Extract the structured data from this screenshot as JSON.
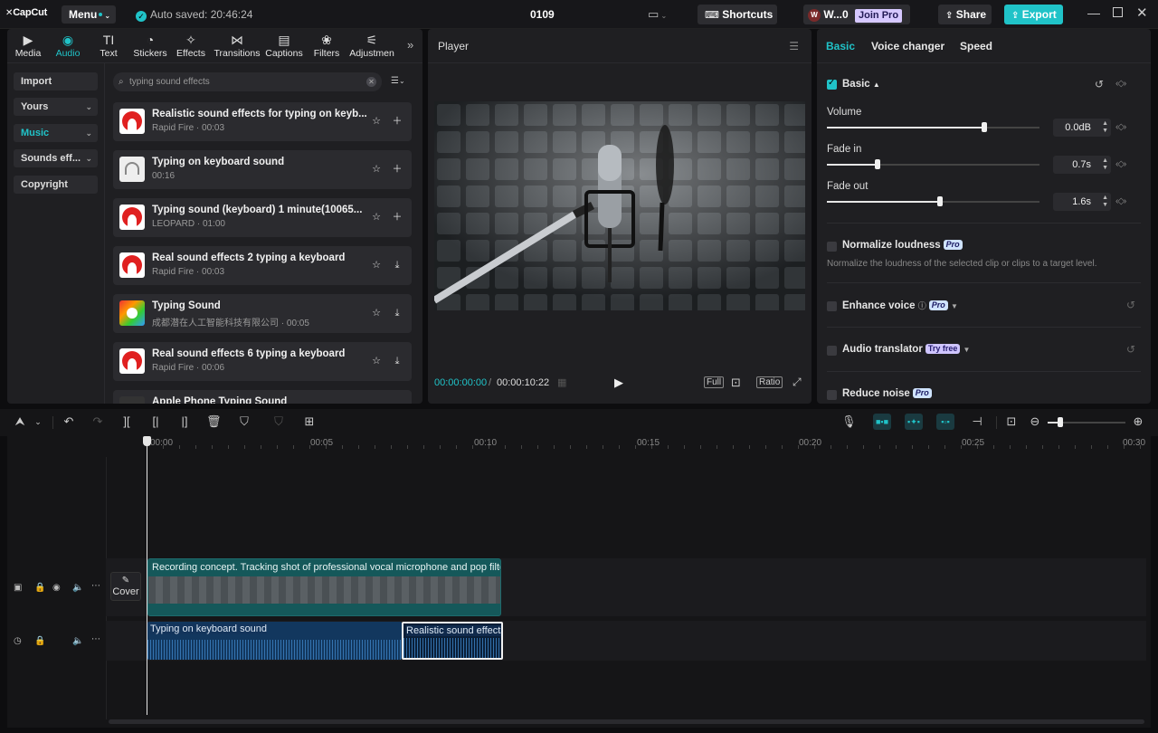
{
  "app": {
    "logo": "CapCut",
    "menu_label": "Menu",
    "autosave": "Auto saved: 20:46:24",
    "project_title": "0109",
    "shortcuts": "Shortcuts",
    "user": "W...0",
    "join_pro": "Join Pro",
    "share": "Share",
    "export": "Export"
  },
  "media": {
    "tabs": [
      {
        "label": "Media",
        "icon": "media-icon"
      },
      {
        "label": "Audio",
        "icon": "audio-icon"
      },
      {
        "label": "Text",
        "icon": "text-icon"
      },
      {
        "label": "Stickers",
        "icon": "stickers-icon"
      },
      {
        "label": "Effects",
        "icon": "effects-icon"
      },
      {
        "label": "Transitions",
        "icon": "transitions-icon"
      },
      {
        "label": "Captions",
        "icon": "captions-icon"
      },
      {
        "label": "Filters",
        "icon": "filters-icon"
      },
      {
        "label": "Adjustmen",
        "icon": "adjustment-icon"
      }
    ],
    "side": [
      "Import",
      "Yours",
      "Music",
      "Sounds eff...",
      "Copyright"
    ],
    "search_placeholder": "typing sound effects",
    "items": [
      {
        "title": "Realistic sound effects for typing on keyb...",
        "sub": "Rapid Fire · 00:03",
        "action": "add"
      },
      {
        "title": "Typing on keyboard sound",
        "sub": "00:16",
        "action": "add"
      },
      {
        "title": "Typing sound (keyboard) 1 minute(10065...",
        "sub": "LEOPARD · 01:00",
        "action": "add"
      },
      {
        "title": "Real sound effects 2 typing a keyboard",
        "sub": "Rapid Fire · 00:03",
        "action": "download"
      },
      {
        "title": "Typing Sound",
        "sub": "成都潜在人工智能科技有限公司 · 00:05",
        "action": "download"
      },
      {
        "title": "Real sound effects 6 typing a keyboard",
        "sub": "Rapid Fire · 00:06",
        "action": "download"
      },
      {
        "title": "Apple Phone Typing Sound",
        "sub": "",
        "action": "download"
      }
    ]
  },
  "player": {
    "title": "Player",
    "current": "00:00:00:00",
    "total": "00:00:10:22",
    "full": "Full",
    "ratio": "Ratio"
  },
  "props": {
    "tabs": [
      "Basic",
      "Voice changer",
      "Speed"
    ],
    "basic_title": "Basic",
    "volume_label": "Volume",
    "volume_value": "0.0dB",
    "volume_level": 0.74,
    "fadein_label": "Fade in",
    "fadein_value": "0.7s",
    "fadein_level": 0.24,
    "fadeout_label": "Fade out",
    "fadeout_value": "1.6s",
    "fadeout_level": 0.53,
    "normalize_title": "Normalize loudness",
    "normalize_desc": "Normalize the loudness of the selected clip or clips to a target level.",
    "enhance_title": "Enhance voice",
    "translator_title": "Audio translator",
    "reduce_title": "Reduce noise",
    "pro": "Pro",
    "try_free": "Try free"
  },
  "timeline": {
    "ruler": [
      "00:00",
      "00:05",
      "00:10",
      "00:15",
      "00:20",
      "00:25",
      "00:30"
    ],
    "cover": "Cover",
    "video_clip": "Recording concept. Tracking shot of professional vocal microphone and pop filter",
    "audio_clip_1": "Typing on keyboard sound",
    "audio_clip_2": "Realistic sound effects"
  }
}
